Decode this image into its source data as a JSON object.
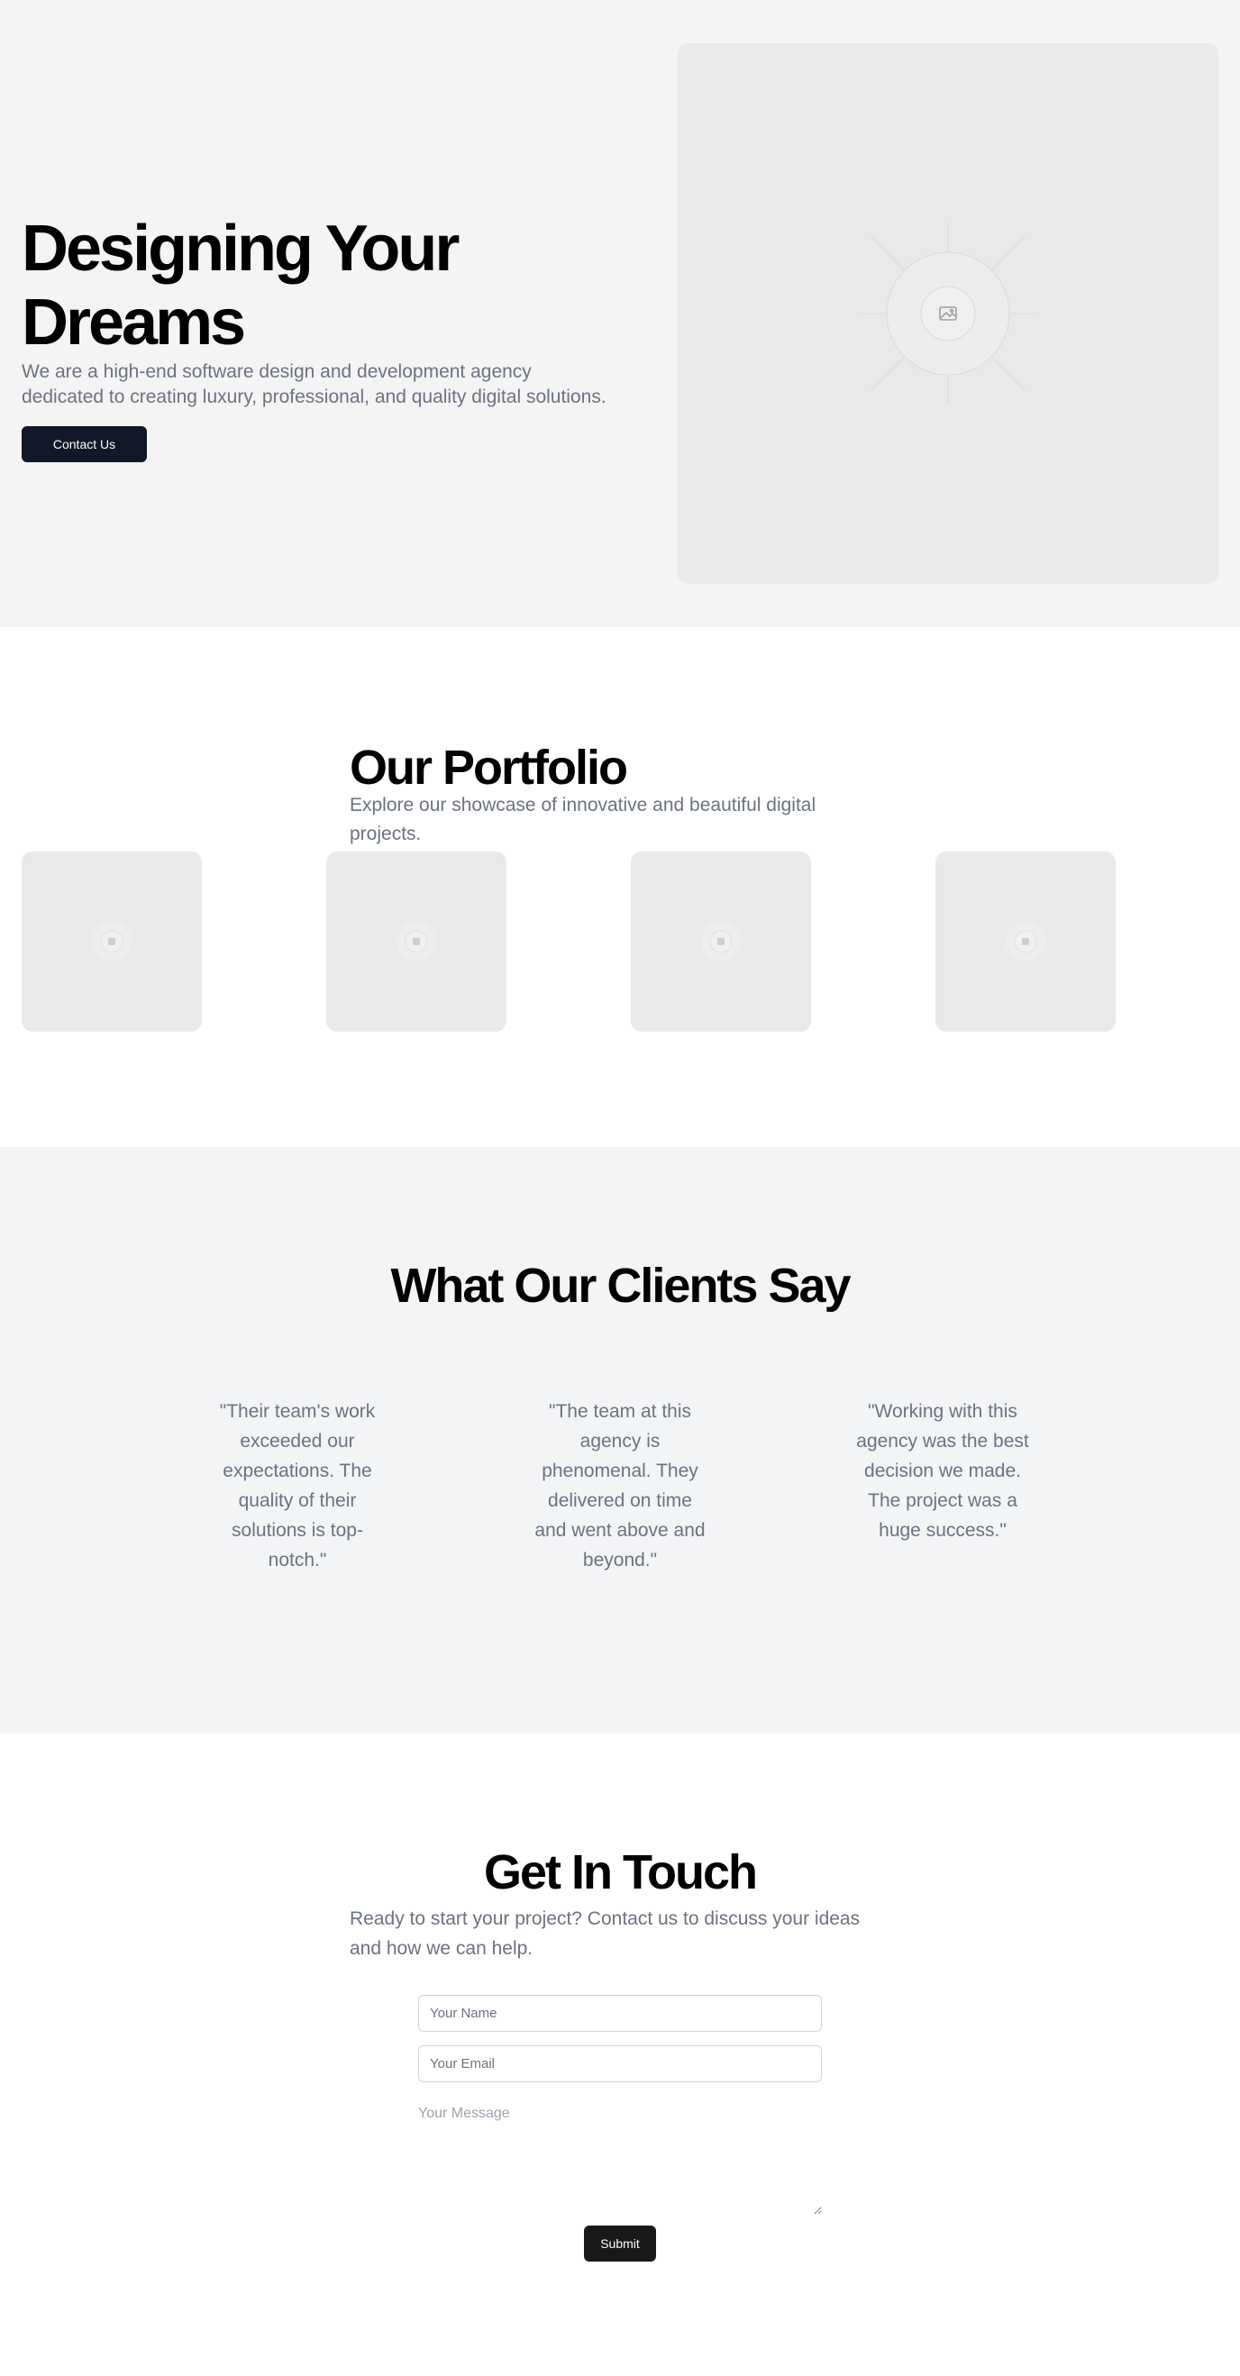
{
  "hero": {
    "title": "Designing Your Dreams",
    "subtitle": "We are a high-end software design and development agency dedicated to creating luxury, professional, and quality digital solutions.",
    "cta_label": "Contact Us",
    "image_icon": "image-placeholder-icon"
  },
  "portfolio": {
    "title": "Our Portfolio",
    "subtitle": "Explore our showcase of innovative and beautiful digital projects.",
    "item_icon": "image-placeholder-icon",
    "item_count": 4
  },
  "testimonials": {
    "title": "What Our Clients Say",
    "quotes": [
      "\"Their team's work exceeded our expectations. The quality of their solutions is top-notch.\"",
      "\"The team at this agency is phenomenal. They delivered on time and went above and beyond.\"",
      "\"Working with this agency was the best decision we made. The project was a huge success.\""
    ]
  },
  "contact": {
    "title": "Get In Touch",
    "subtitle": "Ready to start your project? Contact us to discuss your ideas and how we can help.",
    "name_placeholder": "Your Name",
    "email_placeholder": "Your Email",
    "message_placeholder": "Your Message",
    "submit_label": "Submit"
  },
  "colors": {
    "hero_bg": "#f4f4f4",
    "testimonials_bg": "#f3f4f6",
    "placeholder_bg": "#e9e9e9",
    "button_dark": "#111827",
    "muted_text": "#6b7280"
  }
}
